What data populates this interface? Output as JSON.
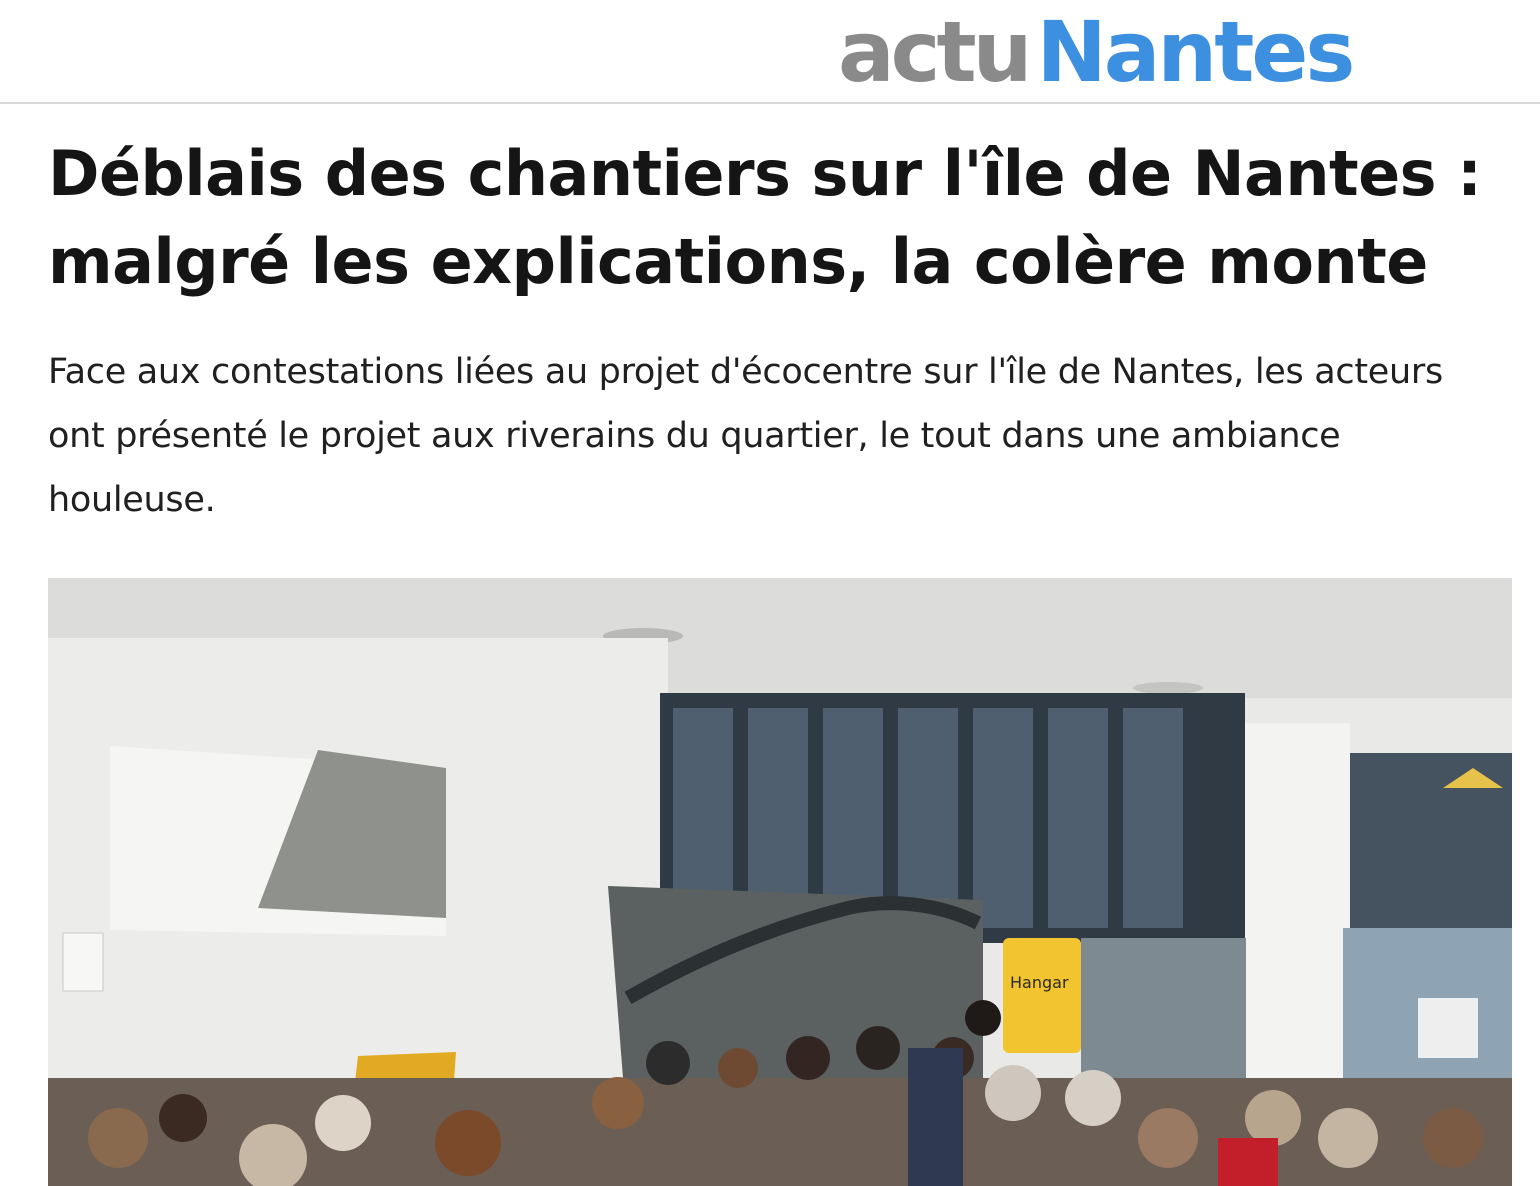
{
  "header": {
    "logo_part1": "actu",
    "logo_part2": "Nantes"
  },
  "article": {
    "title": "Déblais des chantiers sur l'île de Nantes : malgré les explications, la colère monte",
    "lede": "Face aux contestations liées au projet d'écocentre sur l'île de Nantes, les acteurs ont présenté le projet aux riverains du quartier, le tout dans une ambiance houleuse."
  },
  "photo": {
    "sign_text": "Hangar"
  },
  "colors": {
    "logo_gray": "#8a8a8a",
    "logo_blue": "#3d8fe0",
    "sign_yellow": "#f2c530"
  }
}
